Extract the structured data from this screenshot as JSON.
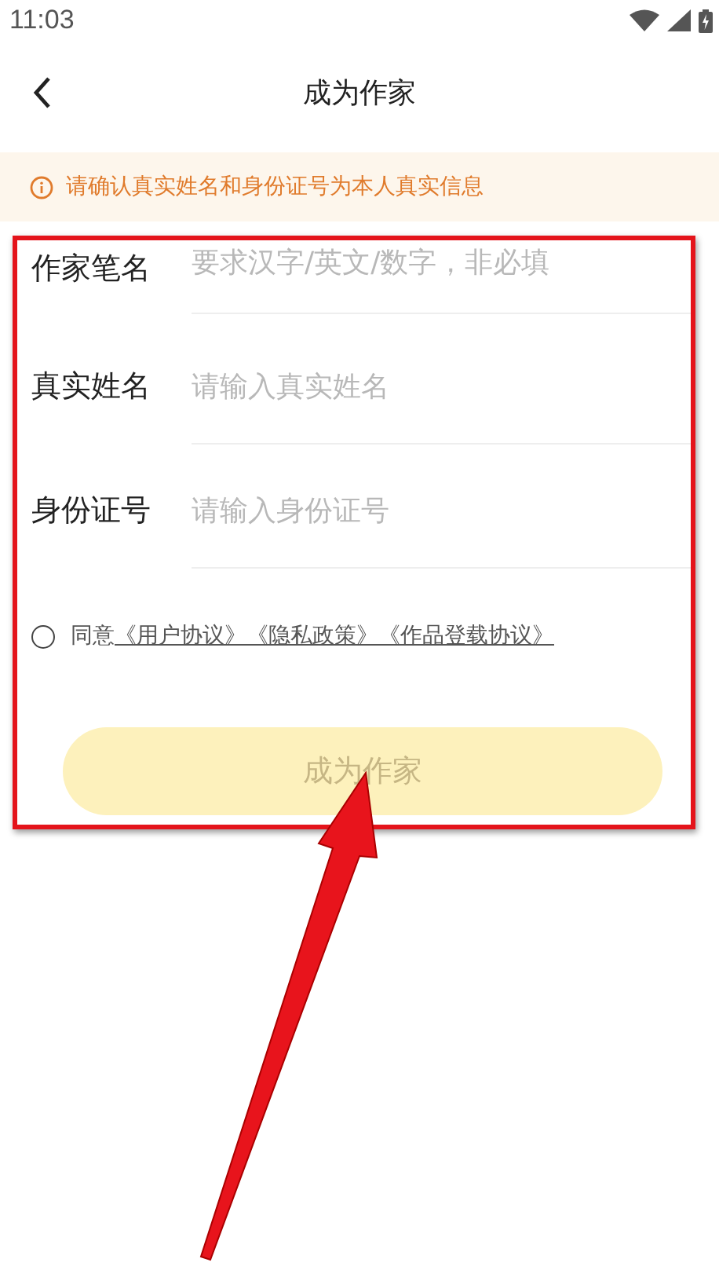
{
  "status_bar": {
    "time": "11:03"
  },
  "header": {
    "title": "成为作家"
  },
  "notice": {
    "text": "请确认真实姓名和身份证号为本人真实信息"
  },
  "form": {
    "fields": [
      {
        "label": "作家笔名",
        "placeholder": "要求汉字/英文/数字，非必填"
      },
      {
        "label": "真实姓名",
        "placeholder": "请输入真实姓名"
      },
      {
        "label": "身份证号",
        "placeholder": "请输入身份证号"
      }
    ],
    "agreement": {
      "checked": false,
      "prefix": "同意",
      "links": [
        "《用户协议》",
        "《隐私政策》",
        "《作品登载协议》"
      ]
    },
    "submit": {
      "label": "成为作家",
      "disabled": true
    }
  }
}
